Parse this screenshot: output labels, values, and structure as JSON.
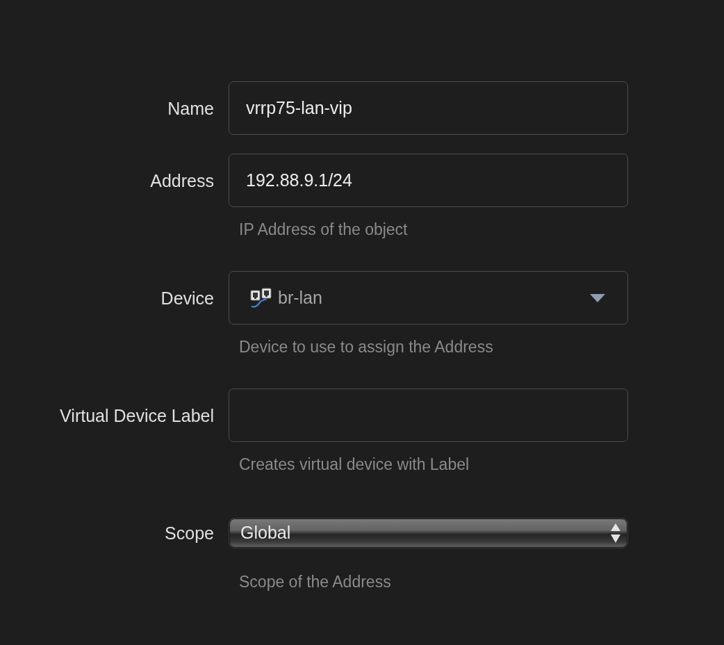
{
  "form": {
    "fields": [
      {
        "kind": "text",
        "label": "Name",
        "value": "vrrp75-lan-vip"
      },
      {
        "kind": "text",
        "label": "Address",
        "value": "192.88.9.1/24",
        "help": "IP Address of the object"
      },
      {
        "kind": "dropdown",
        "label": "Device",
        "value": "br-lan",
        "help": "Device to use to assign the Address"
      },
      {
        "kind": "text",
        "label": "Virtual Device Label",
        "help": "Creates virtual device with Label"
      },
      {
        "kind": "select",
        "label": "Scope",
        "value": "Global",
        "help": "Scope of the Address"
      }
    ]
  }
}
